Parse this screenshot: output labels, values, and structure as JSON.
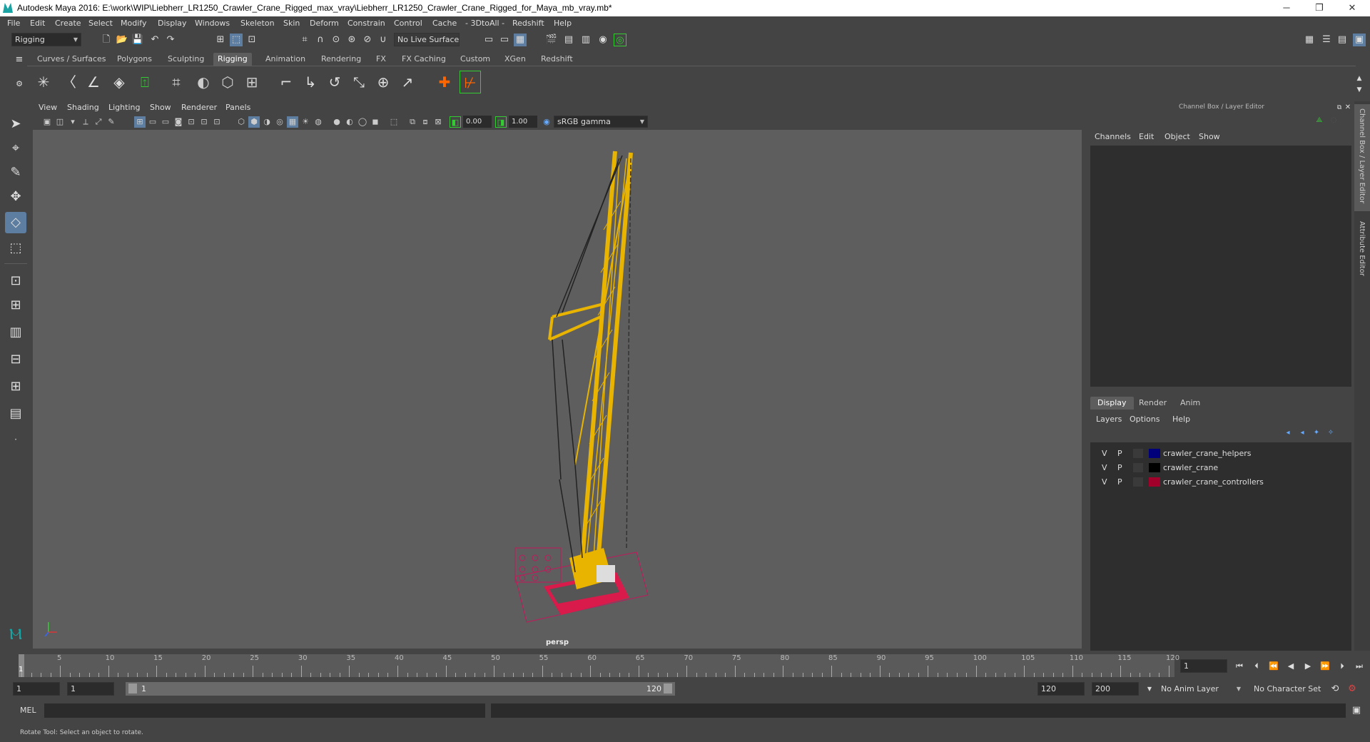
{
  "window": {
    "title": "Autodesk Maya 2016: E:\\work\\WIP\\Liebherr_LR1250_Crawler_Crane_Rigged_max_vray\\Liebherr_LR1250_Crawler_Crane_Rigged_for_Maya_mb_vray.mb*",
    "minimize": "─",
    "restore": "❐",
    "close": "✕"
  },
  "menu": [
    "File",
    "Edit",
    "Create",
    "Select",
    "Modify",
    "Display",
    "Windows",
    "Skeleton",
    "Skin",
    "Deform",
    "Constrain",
    "Control",
    "Cache",
    "- 3DtoAll -",
    "Redshift",
    "Help"
  ],
  "status": {
    "mode": "Rigging",
    "live_surface": "No Live Surface"
  },
  "shelf": {
    "tabs": [
      "Curves / Surfaces",
      "Polygons",
      "Sculpting",
      "Rigging",
      "Animation",
      "Rendering",
      "FX",
      "FX Caching",
      "Custom",
      "XGen",
      "Redshift"
    ],
    "active": "Rigging"
  },
  "viewport": {
    "menu": [
      "View",
      "Shading",
      "Lighting",
      "Show",
      "Renderer",
      "Panels"
    ],
    "gamma_value": "0.00",
    "exposure_value": "1.00",
    "color_space": "sRGB gamma",
    "camera": "persp"
  },
  "channel_box": {
    "title": "Channel Box / Layer Editor",
    "menu": [
      "Channels",
      "Edit",
      "Object",
      "Show"
    ]
  },
  "layer_editor": {
    "tabs": [
      "Display",
      "Render",
      "Anim"
    ],
    "active_tab": "Display",
    "menu": [
      "Layers",
      "Options",
      "Help"
    ],
    "layers": [
      {
        "v": "V",
        "p": "P",
        "color": "#00007a",
        "name": "crawler_crane_helpers"
      },
      {
        "v": "V",
        "p": "P",
        "color": "#000000",
        "name": "crawler_crane"
      },
      {
        "v": "V",
        "p": "P",
        "color": "#a0002a",
        "name": "crawler_crane_controllers"
      }
    ]
  },
  "side_tabs": [
    "Channel Box / Layer Editor",
    "Attribute Editor"
  ],
  "timeline": {
    "ticks": [
      "1",
      "5",
      "10",
      "15",
      "20",
      "25",
      "30",
      "35",
      "40",
      "45",
      "50",
      "55",
      "60",
      "65",
      "70",
      "75",
      "80",
      "85",
      "90",
      "95",
      "100",
      "105",
      "110",
      "115",
      "120"
    ],
    "current_frame": "1"
  },
  "range": {
    "start": "1",
    "playback_start": "1",
    "slider_start": "1",
    "slider_end": "120",
    "playback_end": "120",
    "end": "200",
    "anim_layer": "No Anim Layer",
    "character_set": "No Character Set"
  },
  "mel": {
    "label": "MEL"
  },
  "help_line": "Rotate Tool: Select an object to rotate."
}
